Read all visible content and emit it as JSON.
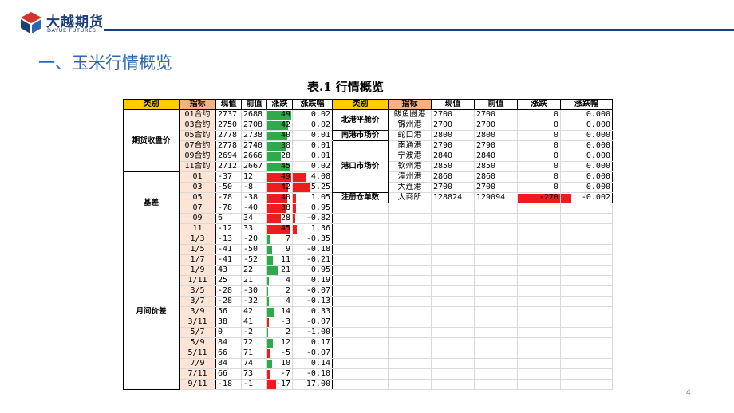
{
  "header": {
    "logo_cn": "大越期货",
    "logo_en": "DAYUE FUTURES",
    "colors": {
      "brand": "#1c3f78",
      "accent": "#2e66b6",
      "logo_red": "#d4322c"
    }
  },
  "section_title": "一、玉米行情概览",
  "table_title": "表.1  行情概览",
  "page_number": "4",
  "left_table": {
    "headers": [
      "类别",
      "指标",
      "现值",
      "前值",
      "涨跌",
      "涨跌幅"
    ],
    "groups": [
      {
        "category": "期货收盘价",
        "rows": [
          {
            "ind": "01合约",
            "cur": "2737",
            "prev": "2688",
            "chg": "49",
            "pct": "0.02",
            "bar": "g"
          },
          {
            "ind": "03合约",
            "cur": "2750",
            "prev": "2708",
            "chg": "42",
            "pct": "0.02",
            "bar": "g"
          },
          {
            "ind": "05合约",
            "cur": "2778",
            "prev": "2738",
            "chg": "40",
            "pct": "0.01",
            "bar": "g"
          },
          {
            "ind": "07合约",
            "cur": "2778",
            "prev": "2740",
            "chg": "38",
            "pct": "0.01",
            "bar": "g"
          },
          {
            "ind": "09合约",
            "cur": "2694",
            "prev": "2666",
            "chg": "28",
            "pct": "0.01",
            "bar": "g"
          },
          {
            "ind": "11合约",
            "cur": "2712",
            "prev": "2667",
            "chg": "45",
            "pct": "0.02",
            "bar": "g"
          }
        ]
      },
      {
        "category": "基差",
        "rows": [
          {
            "ind": "01",
            "cur": "-37",
            "prev": "12",
            "chg": "49",
            "pct": "4.08",
            "bar": "r"
          },
          {
            "ind": "03",
            "cur": "-50",
            "prev": "-8",
            "chg": "42",
            "pct": "5.25",
            "bar": "r"
          },
          {
            "ind": "05",
            "cur": "-78",
            "prev": "-38",
            "chg": "40",
            "pct": "1.05",
            "bar": "r"
          },
          {
            "ind": "07",
            "cur": "-78",
            "prev": "-40",
            "chg": "38",
            "pct": "0.95",
            "bar": "r"
          },
          {
            "ind": "09",
            "cur": "6",
            "prev": "34",
            "chg": "28",
            "pct": "-0.82",
            "bar": "r"
          },
          {
            "ind": "11",
            "cur": "-12",
            "prev": "33",
            "chg": "45",
            "pct": "1.36",
            "bar": "r"
          }
        ]
      },
      {
        "category": "月间价差",
        "rows": [
          {
            "ind": "1/3",
            "cur": "-13",
            "prev": "-20",
            "chg": "7",
            "pct": "-0.35",
            "bar": "g"
          },
          {
            "ind": "1/5",
            "cur": "-41",
            "prev": "-50",
            "chg": "9",
            "pct": "-0.18",
            "bar": "g"
          },
          {
            "ind": "1/7",
            "cur": "-41",
            "prev": "-52",
            "chg": "11",
            "pct": "-0.21",
            "bar": "g"
          },
          {
            "ind": "1/9",
            "cur": "43",
            "prev": "22",
            "chg": "21",
            "pct": "0.95",
            "bar": "g"
          },
          {
            "ind": "1/11",
            "cur": "25",
            "prev": "21",
            "chg": "4",
            "pct": "0.19",
            "bar": "g"
          },
          {
            "ind": "3/5",
            "cur": "-28",
            "prev": "-30",
            "chg": "2",
            "pct": "-0.07",
            "bar": "g"
          },
          {
            "ind": "3/7",
            "cur": "-28",
            "prev": "-32",
            "chg": "4",
            "pct": "-0.13",
            "bar": "g"
          },
          {
            "ind": "3/9",
            "cur": "56",
            "prev": "42",
            "chg": "14",
            "pct": "0.33",
            "bar": "g"
          },
          {
            "ind": "3/11",
            "cur": "38",
            "prev": "41",
            "chg": "-3",
            "pct": "-0.07",
            "bar": "r"
          },
          {
            "ind": "5/7",
            "cur": "0",
            "prev": "-2",
            "chg": "2",
            "pct": "-1.00",
            "bar": "g"
          },
          {
            "ind": "5/9",
            "cur": "84",
            "prev": "72",
            "chg": "12",
            "pct": "0.17",
            "bar": "g"
          },
          {
            "ind": "5/11",
            "cur": "66",
            "prev": "71",
            "chg": "-5",
            "pct": "-0.07",
            "bar": "r"
          },
          {
            "ind": "7/9",
            "cur": "84",
            "prev": "74",
            "chg": "10",
            "pct": "0.14",
            "bar": "g"
          },
          {
            "ind": "7/11",
            "cur": "66",
            "prev": "73",
            "chg": "-7",
            "pct": "-0.10",
            "bar": "r"
          },
          {
            "ind": "9/11",
            "cur": "-18",
            "prev": "-1",
            "chg": "-17",
            "pct": "17.00",
            "bar": "r"
          }
        ]
      }
    ]
  },
  "right_table": {
    "headers": [
      "类别",
      "指标",
      "现值",
      "前值",
      "涨跌",
      "涨跌幅"
    ],
    "groups": [
      {
        "category": "北港平舱价",
        "rows": [
          {
            "ind": "鲅鱼圈港",
            "cur": "2700",
            "prev": "2700",
            "chg": "0",
            "pct": "0.000"
          },
          {
            "ind": "锦州港",
            "cur": "2700",
            "prev": "2700",
            "chg": "0",
            "pct": "0.000"
          }
        ]
      },
      {
        "category": "南港市场价",
        "rows": [
          {
            "ind": "蛇口港",
            "cur": "2800",
            "prev": "2800",
            "chg": "0",
            "pct": "0.000"
          }
        ]
      },
      {
        "category": "港口市场价",
        "rows": [
          {
            "ind": "南通港",
            "cur": "2790",
            "prev": "2790",
            "chg": "0",
            "pct": "0.000"
          },
          {
            "ind": "宁波港",
            "cur": "2840",
            "prev": "2840",
            "chg": "0",
            "pct": "0.000"
          },
          {
            "ind": "钦州港",
            "cur": "2850",
            "prev": "2850",
            "chg": "0",
            "pct": "0.000"
          },
          {
            "ind": "漳州港",
            "cur": "2860",
            "prev": "2860",
            "chg": "0",
            "pct": "0.000"
          },
          {
            "ind": "大连港",
            "cur": "2700",
            "prev": "2700",
            "chg": "0",
            "pct": "0.000"
          }
        ]
      },
      {
        "category": "注册仓单数",
        "rows": [
          {
            "ind": "大商所",
            "cur": "128824",
            "prev": "129094",
            "chg": "-270",
            "pct": "-0.002",
            "bar": "r"
          }
        ]
      }
    ]
  }
}
